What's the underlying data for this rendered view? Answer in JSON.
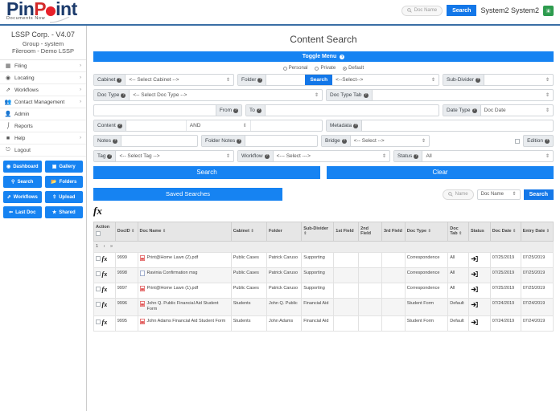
{
  "header": {
    "logo_primary": "Pin",
    "logo_accent": "P",
    "logo_tail": "int",
    "logo_tagline": "Documents Now",
    "search_placeholder": "Doc Name",
    "search_button": "Search",
    "user_name": "System2 System2",
    "user_badge_icon": "user-badge-icon",
    "accent_color": "#1683f2",
    "logo_red": "#e8212b",
    "logo_navy": "#1b3a6b"
  },
  "sidebar": {
    "corp": "LSSP Corp. - V4.07",
    "group": "Group - system",
    "fileroom": "Fileroom - Demo LSSP",
    "nav": [
      {
        "label": "Filing",
        "icon": "filing-icon",
        "chevron": "›"
      },
      {
        "label": "Locating",
        "icon": "locating-icon",
        "chevron": "›"
      },
      {
        "label": "Workflows",
        "icon": "workflows-icon",
        "chevron": "›"
      },
      {
        "label": "Contact Management",
        "icon": "contacts-icon",
        "chevron": "›"
      },
      {
        "label": "Admin",
        "icon": "admin-icon",
        "chevron": ""
      },
      {
        "label": "Reports",
        "icon": "reports-icon",
        "chevron": ""
      },
      {
        "label": "Help",
        "icon": "help-icon",
        "chevron": "›"
      },
      {
        "label": "Logout",
        "icon": "logout-icon",
        "chevron": ""
      }
    ],
    "buttons": [
      {
        "label": "Dashboard",
        "icon": "dashboard-icon"
      },
      {
        "label": "Gallery",
        "icon": "gallery-icon"
      },
      {
        "label": "Search",
        "icon": "search-icon"
      },
      {
        "label": "Folders",
        "icon": "folders-icon"
      },
      {
        "label": "Workflows",
        "icon": "workflows-icon"
      },
      {
        "label": "Upload",
        "icon": "upload-icon"
      },
      {
        "label": "Last Doc",
        "icon": "last-doc-icon"
      },
      {
        "label": "Shared",
        "icon": "shared-icon"
      }
    ]
  },
  "main": {
    "page_title": "Content Search",
    "toggle_menu": "Toggle Menu",
    "scope_options": [
      {
        "label": "Personal",
        "selected": false
      },
      {
        "label": "Private",
        "selected": false
      },
      {
        "label": "Default",
        "selected": true
      }
    ],
    "form": {
      "cabinet_label": "Cabinet",
      "cabinet_value": "<-- Select Cabinet -->",
      "folder_label": "Folder",
      "folder_value": "",
      "folder_search_button": "Search",
      "folder_select_value": "<--Select-->",
      "subdivider_label": "Sub-Divider",
      "subdivider_value": "",
      "doctype_label": "Doc Type",
      "doctype_value": "<-- Select Doc Type -->",
      "doctypetab_label": "Doc Type Tab",
      "doctypetab_value": "",
      "from_label": "From",
      "from_value": "",
      "to_label": "To",
      "to_value": "",
      "datetype_label": "Date Type",
      "datetype_value": "Doc Date",
      "content_label": "Content",
      "content_value": "",
      "content_operator": "AND",
      "content_value2": "",
      "metadata_label": "Metadata",
      "metadata_value": "",
      "notes_label": "Notes",
      "notes_value": "",
      "foldernotes_label": "Folder Notes",
      "foldernotes_value": "",
      "bridge_label": "Bridge",
      "bridge_value": "<-- Select -->",
      "edition_label": "Edition",
      "tag_label": "Tag",
      "tag_value": "<-- Select Tag -->",
      "workflow_label": "Workflow",
      "workflow_value": "<--- Select --->",
      "status_label": "Status",
      "status_value": "All",
      "search_button": "Search",
      "clear_button": "Clear"
    },
    "saved_searches_button": "Saved Searches",
    "results_search_placeholder": "Name",
    "results_filter_value": "Doc Name",
    "results_search_button": "Search",
    "fx_symbol": "fx"
  },
  "table": {
    "columns": [
      {
        "label": "Action",
        "sortable": false
      },
      {
        "label": "DocID",
        "sortable": true
      },
      {
        "label": "Doc Name",
        "sortable": true
      },
      {
        "label": "Cabinet",
        "sortable": true
      },
      {
        "label": "Folder",
        "sortable": false
      },
      {
        "label": "Sub-Divider",
        "sortable": true
      },
      {
        "label": "1st Field",
        "sortable": false
      },
      {
        "label": "2nd Field",
        "sortable": false
      },
      {
        "label": "3rd Field",
        "sortable": false
      },
      {
        "label": "Doc Type",
        "sortable": true
      },
      {
        "label": "Doc Tab",
        "sortable": true
      },
      {
        "label": "Status",
        "sortable": false
      },
      {
        "label": "Doc Date",
        "sortable": true
      },
      {
        "label": "Entry Date",
        "sortable": true
      }
    ],
    "pagination": [
      "1",
      "›",
      "»"
    ],
    "rows": [
      {
        "action": "fx",
        "docid": "9999",
        "doc_name": "Print@Home Lawn (2).pdf",
        "file_icon": "pdf-icon",
        "cabinet": "Public Cases",
        "folder": "Patrick Caruso",
        "subdivider": "Supporting",
        "field1": "",
        "field2": "",
        "field3": "",
        "doc_type": "Correspondence",
        "doc_tab": "All",
        "status": "login-icon",
        "doc_date": "07/25/2019",
        "entry_date": "07/25/2019"
      },
      {
        "action": "fx",
        "docid": "9998",
        "doc_name": "Ravinia Confirmation msg",
        "file_icon": "msg-icon",
        "cabinet": "Public Cases",
        "folder": "Patrick Caruso",
        "subdivider": "Supporting",
        "field1": "",
        "field2": "",
        "field3": "",
        "doc_type": "Correspondence",
        "doc_tab": "All",
        "status": "login-icon",
        "doc_date": "07/25/2019",
        "entry_date": "07/25/2019"
      },
      {
        "action": "fx",
        "docid": "9997",
        "doc_name": "Print@Home Lawn (1).pdf",
        "file_icon": "pdf-icon",
        "cabinet": "Public Cases",
        "folder": "Patrick Caruso",
        "subdivider": "Supporting",
        "field1": "",
        "field2": "",
        "field3": "",
        "doc_type": "Correspondence",
        "doc_tab": "All",
        "status": "login-icon",
        "doc_date": "07/25/2019",
        "entry_date": "07/25/2019"
      },
      {
        "action": "fx",
        "docid": "9996",
        "doc_name": "John Q. Public Financial Aid Student Form",
        "file_icon": "pdf-icon",
        "cabinet": "Students",
        "folder": "John Q. Public",
        "subdivider": "Financial Aid",
        "field1": "",
        "field2": "",
        "field3": "",
        "doc_type": "Student Form",
        "doc_tab": "Default",
        "status": "login-icon",
        "doc_date": "07/24/2019",
        "entry_date": "07/24/2019"
      },
      {
        "action": "fx",
        "docid": "9995",
        "doc_name": "John Adams Financial Aid Student Form",
        "file_icon": "pdf-icon",
        "cabinet": "Students",
        "folder": "John Adams",
        "subdivider": "Financial Aid",
        "field1": "",
        "field2": "",
        "field3": "",
        "doc_type": "Student Form",
        "doc_tab": "Default",
        "status": "login-icon",
        "doc_date": "07/24/2019",
        "entry_date": "07/24/2019"
      }
    ]
  }
}
